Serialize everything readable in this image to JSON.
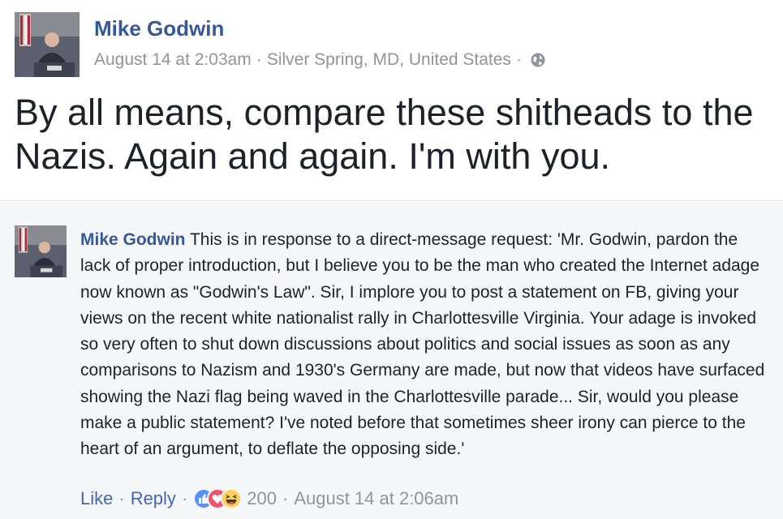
{
  "post": {
    "author": "Mike Godwin",
    "date": "August 14 at 2:03am",
    "separator": "·",
    "location": "Silver Spring, MD, United States",
    "privacy_icon": "globe-icon",
    "body": "By all means, compare these shitheads to the Nazis. Again and again. I'm with you."
  },
  "comment": {
    "author": "Mike Godwin",
    "text": "This is in response to a direct-message request: 'Mr. Godwin, pardon the lack of proper introduction, but I believe you to be the man who created the Internet adage now known as \"Godwin's Law\". Sir, I implore you to post a statement on FB, giving your views on the recent white nationalist rally in Charlottesville Virginia. Your adage is invoked so very often to shut down discussions about politics and social issues as soon as any comparisons to Nazism and 1930's Germany are made, but now that videos have surfaced showing the Nazi flag being waved in the Charlottesville parade... Sir, would you please make a public statement? I've noted before that sometimes sheer irony can pierce to the heart of an argument, to deflate the opposing side.'",
    "like_label": "Like",
    "reply_label": "Reply",
    "separator": "·",
    "reaction_icons": [
      "like-reaction-icon",
      "love-reaction-icon",
      "haha-reaction-icon"
    ],
    "reaction_count": "200",
    "date": "August 14 at 2:06am"
  },
  "colors": {
    "link": "#365899",
    "action": "#4267b2",
    "meta": "#90949c",
    "text": "#1d2129",
    "comment_bg": "#f6f7f9"
  }
}
